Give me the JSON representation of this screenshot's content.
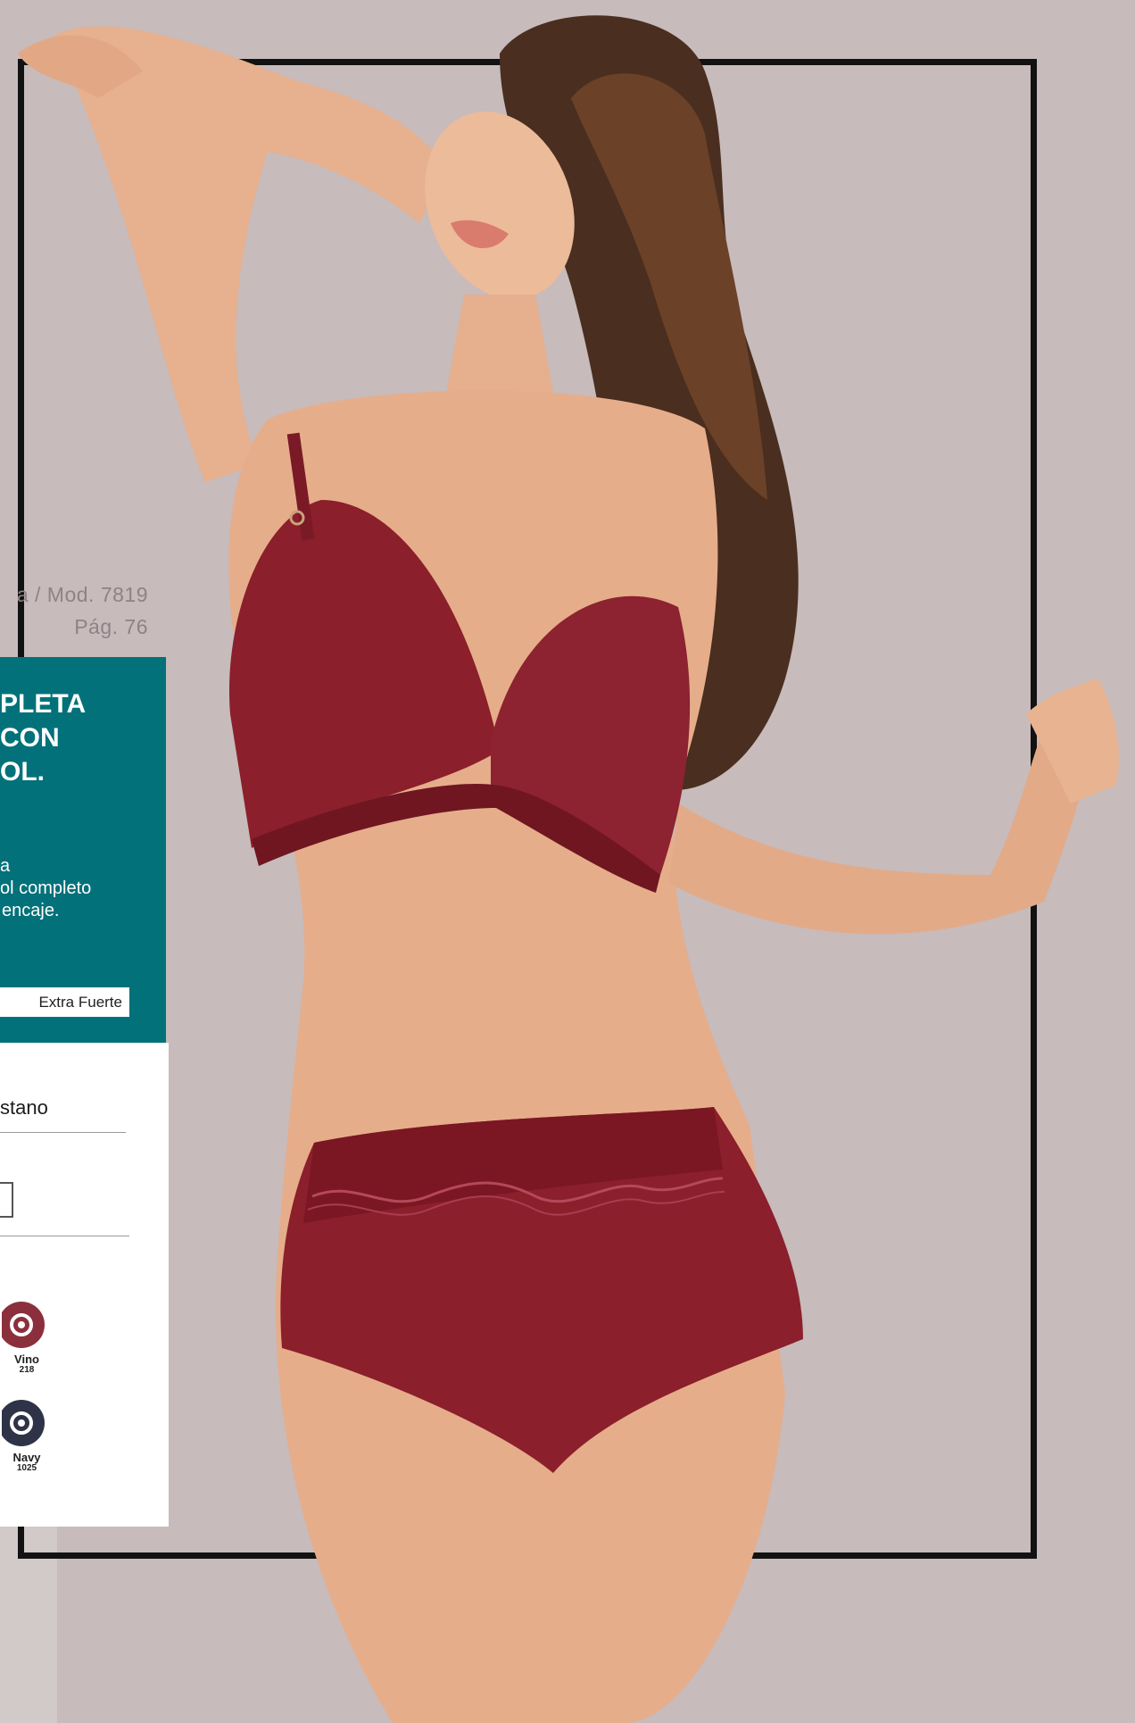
{
  "reference": {
    "line1": "a / Mod. 7819",
    "line2": "Pág. 76"
  },
  "feature_panel": {
    "title_lines": [
      "PLETA",
      "CON",
      "OL."
    ],
    "description_lines": [
      "a",
      "ol completo",
      "encaje."
    ],
    "control_label": "Extra Fuerte",
    "background": "#02717a"
  },
  "details_panel": {
    "color_name": "stano",
    "swatches": [
      {
        "name": "Vino",
        "code": "218",
        "color": "#8c2f3c",
        "icon": "swirl-swatch-icon"
      },
      {
        "name": "Navy",
        "code": "1025",
        "color": "#2f3347",
        "icon": "swirl-swatch-icon"
      }
    ]
  },
  "photo": {
    "subject": "model-photo",
    "garment_color": "#8b1f2b"
  }
}
